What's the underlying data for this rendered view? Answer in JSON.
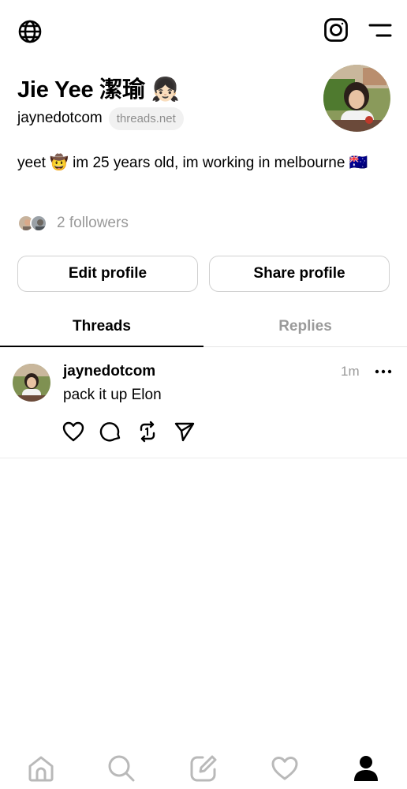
{
  "profile": {
    "name": "Jie Yee 潔瑜 👧🏻",
    "handle": "jaynedotcom",
    "domain": "threads.net",
    "bio": "yeet 🤠 im 25 years old, im working in melbourne 🇦🇺",
    "followers_text": "2 followers"
  },
  "buttons": {
    "edit": "Edit profile",
    "share": "Share profile"
  },
  "tabs": [
    {
      "label": "Threads",
      "active": true
    },
    {
      "label": "Replies",
      "active": false
    }
  ],
  "post": {
    "username": "jaynedotcom",
    "time": "1m",
    "text": "pack it up Elon"
  },
  "icons": {
    "top": [
      "globe-icon",
      "instagram-icon",
      "menu-icon"
    ],
    "post_actions": [
      "heart-icon",
      "comment-icon",
      "repost-icon",
      "send-icon"
    ],
    "nav": [
      "home-icon",
      "search-icon",
      "compose-icon",
      "activity-heart-icon",
      "profile-icon"
    ]
  },
  "colors": {
    "text": "#000000",
    "muted": "#999999",
    "border": "#d0d0d0"
  }
}
